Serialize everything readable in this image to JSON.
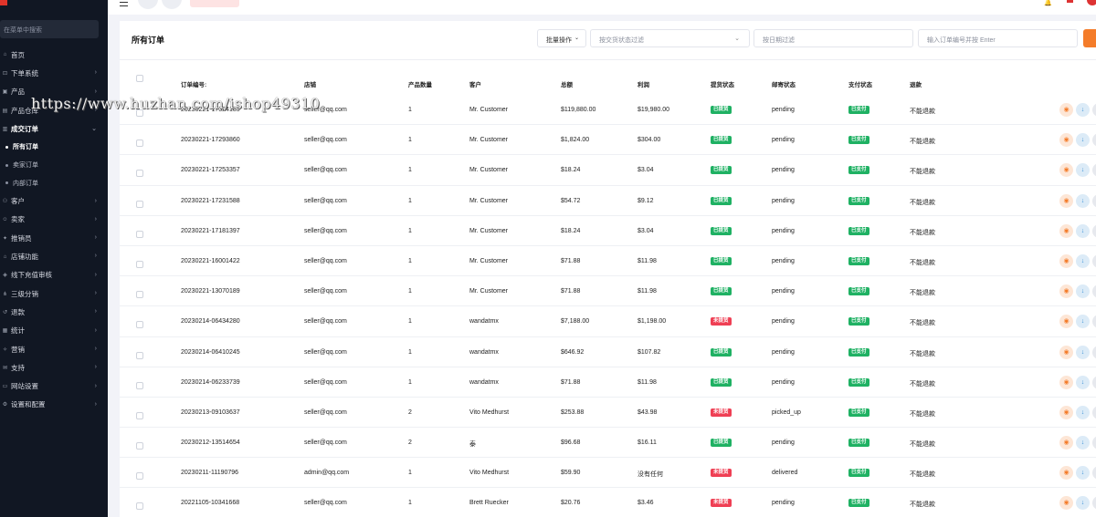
{
  "sidebar": {
    "search_placeholder": "在菜单中搜索",
    "items": [
      {
        "label": "首页",
        "icon": "home-icon",
        "arrow": ""
      },
      {
        "label": "下单系统",
        "icon": "cart-icon",
        "arrow": "›"
      },
      {
        "label": "产品",
        "icon": "box-icon",
        "arrow": "›"
      },
      {
        "label": "产品仓库",
        "icon": "warehouse-icon",
        "arrow": "›"
      },
      {
        "label": "成交订单",
        "icon": "orders-icon",
        "arrow": "⌄"
      }
    ],
    "sub_items": [
      {
        "label": "所有订单"
      },
      {
        "label": "卖家订单"
      },
      {
        "label": "内部订单"
      }
    ],
    "items_after": [
      {
        "label": "客户",
        "icon": "users-icon",
        "arrow": "›"
      },
      {
        "label": "卖家",
        "icon": "seller-icon",
        "arrow": "›"
      },
      {
        "label": "推销员",
        "icon": "salesman-icon",
        "arrow": "›"
      },
      {
        "label": "店铺功能",
        "icon": "store-icon",
        "arrow": "›"
      },
      {
        "label": "线下充值审核",
        "icon": "recharge-icon",
        "arrow": "›"
      },
      {
        "label": "三级分销",
        "icon": "distribution-icon",
        "arrow": "›"
      },
      {
        "label": "退款",
        "icon": "refund-icon",
        "arrow": "›"
      },
      {
        "label": "统计",
        "icon": "stats-icon",
        "arrow": "›"
      },
      {
        "label": "营销",
        "icon": "marketing-icon",
        "arrow": "›"
      },
      {
        "label": "支持",
        "icon": "support-icon",
        "arrow": "›"
      },
      {
        "label": "网站设置",
        "icon": "monitor-icon",
        "arrow": "›"
      },
      {
        "label": "设置和配置",
        "icon": "gear-icon",
        "arrow": "›"
      }
    ]
  },
  "page": {
    "title": "所有订单",
    "batch_label": "批量操作",
    "status_filter_placeholder": "按交货状态过滤",
    "date_filter_placeholder": "按日期过滤",
    "search_placeholder": "输入订单编号并按 Enter"
  },
  "table": {
    "headers": {
      "id": "订单编号:",
      "shop": "店铺",
      "qty": "产品数量",
      "customer": "客户",
      "total": "总额",
      "profit": "利润",
      "pickup": "提货状态",
      "mail": "邮寄状态",
      "payment": "支付状态",
      "refund": "退款"
    },
    "rows": [
      {
        "id": "20230221-17324185",
        "shop": "seller@qq.com",
        "qty": "1",
        "customer": "Mr. Customer",
        "total": "$119,880.00",
        "profit": "$19,980.00",
        "pickup": "已提货",
        "pickup_color": "green",
        "mail": "pending",
        "payment": "已支付",
        "refund": "不能退款"
      },
      {
        "id": "20230221-17293860",
        "shop": "seller@qq.com",
        "qty": "1",
        "customer": "Mr. Customer",
        "total": "$1,824.00",
        "profit": "$304.00",
        "pickup": "已提货",
        "pickup_color": "green",
        "mail": "pending",
        "payment": "已支付",
        "refund": "不能退款"
      },
      {
        "id": "20230221-17253357",
        "shop": "seller@qq.com",
        "qty": "1",
        "customer": "Mr. Customer",
        "total": "$18.24",
        "profit": "$3.04",
        "pickup": "已提货",
        "pickup_color": "green",
        "mail": "pending",
        "payment": "已支付",
        "refund": "不能退款"
      },
      {
        "id": "20230221-17231588",
        "shop": "seller@qq.com",
        "qty": "1",
        "customer": "Mr. Customer",
        "total": "$54.72",
        "profit": "$9.12",
        "pickup": "已提货",
        "pickup_color": "green",
        "mail": "pending",
        "payment": "已支付",
        "refund": "不能退款"
      },
      {
        "id": "20230221-17181397",
        "shop": "seller@qq.com",
        "qty": "1",
        "customer": "Mr. Customer",
        "total": "$18.24",
        "profit": "$3.04",
        "pickup": "已提货",
        "pickup_color": "green",
        "mail": "pending",
        "payment": "已支付",
        "refund": "不能退款"
      },
      {
        "id": "20230221-16001422",
        "shop": "seller@qq.com",
        "qty": "1",
        "customer": "Mr. Customer",
        "total": "$71.88",
        "profit": "$11.98",
        "pickup": "已提货",
        "pickup_color": "green",
        "mail": "pending",
        "payment": "已支付",
        "refund": "不能退款"
      },
      {
        "id": "20230221-13070189",
        "shop": "seller@qq.com",
        "qty": "1",
        "customer": "Mr. Customer",
        "total": "$71.88",
        "profit": "$11.98",
        "pickup": "已提货",
        "pickup_color": "green",
        "mail": "pending",
        "payment": "已支付",
        "refund": "不能退款"
      },
      {
        "id": "20230214-06434280",
        "shop": "seller@qq.com",
        "qty": "1",
        "customer": "wandatmx",
        "total": "$7,188.00",
        "profit": "$1,198.00",
        "pickup": "未提货",
        "pickup_color": "red",
        "mail": "pending",
        "payment": "已支付",
        "refund": "不能退款"
      },
      {
        "id": "20230214-06410245",
        "shop": "seller@qq.com",
        "qty": "1",
        "customer": "wandatmx",
        "total": "$646.92",
        "profit": "$107.82",
        "pickup": "已提货",
        "pickup_color": "green",
        "mail": "pending",
        "payment": "已支付",
        "refund": "不能退款"
      },
      {
        "id": "20230214-06233739",
        "shop": "seller@qq.com",
        "qty": "1",
        "customer": "wandatmx",
        "total": "$71.88",
        "profit": "$11.98",
        "pickup": "已提货",
        "pickup_color": "green",
        "mail": "pending",
        "payment": "已支付",
        "refund": "不能退款"
      },
      {
        "id": "20230213-09103637",
        "shop": "seller@qq.com",
        "qty": "2",
        "customer": "Vito Medhurst",
        "total": "$253.88",
        "profit": "$43.98",
        "pickup": "未提货",
        "pickup_color": "red",
        "mail": "picked_up",
        "payment": "已支付",
        "refund": "不能退款"
      },
      {
        "id": "20230212-13514654",
        "shop": "seller@qq.com",
        "qty": "2",
        "customer": "泰",
        "total": "$96.68",
        "profit": "$16.11",
        "pickup": "已提货",
        "pickup_color": "green",
        "mail": "pending",
        "payment": "已支付",
        "refund": "不能退款"
      },
      {
        "id": "20230211-11190796",
        "shop": "admin@qq.com",
        "qty": "1",
        "customer": "Vito Medhurst",
        "total": "$59.90",
        "profit": "没有任何",
        "pickup": "未提货",
        "pickup_color": "red",
        "mail": "delivered",
        "payment": "已支付",
        "refund": "不能退款"
      },
      {
        "id": "20221105-10341668",
        "shop": "seller@qq.com",
        "qty": "1",
        "customer": "Brett Ruecker",
        "total": "$20.76",
        "profit": "$3.46",
        "pickup": "未提货",
        "pickup_color": "red",
        "mail": "pending",
        "payment": "已支付",
        "refund": "不能退款"
      }
    ]
  },
  "watermark": "https://www.huzhan.com/ishop49310",
  "colors": {
    "sidebar_bg": "#111723",
    "accent": "#f47c2a",
    "green": "#1fb163",
    "red": "#ef3f54"
  }
}
